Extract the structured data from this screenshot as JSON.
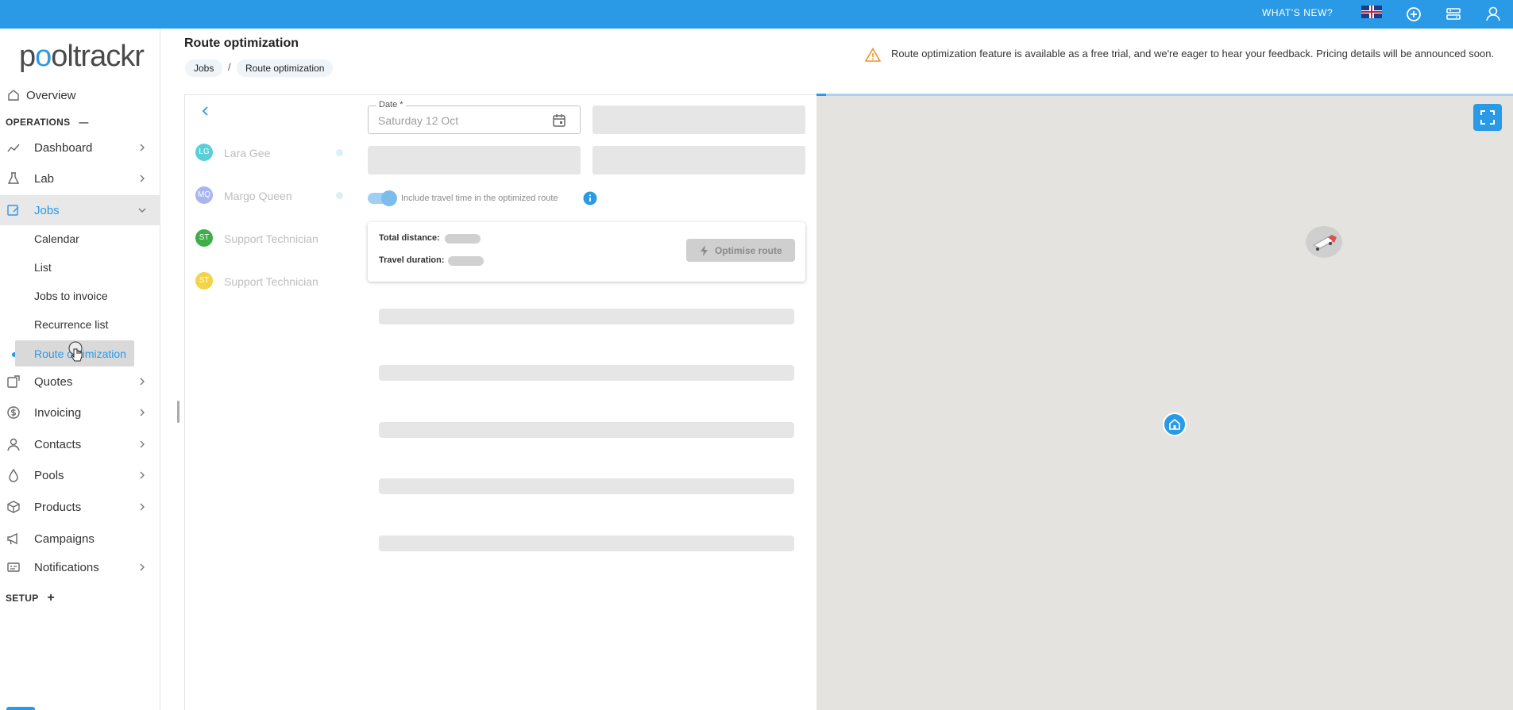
{
  "header": {
    "whats_new": "WHAT'S NEW?",
    "accent_color": "#2a9ae6"
  },
  "logo": {
    "text_pre": "p",
    "text_pin": "o",
    "text_post": "oltrackr"
  },
  "sidebar": {
    "overview": "Overview",
    "operations_label": "OPERATIONS",
    "operations_toggle": "—",
    "items": [
      {
        "label": "Dashboard",
        "icon": "chart-line-icon"
      },
      {
        "label": "Lab",
        "icon": "flask-icon"
      },
      {
        "label": "Jobs",
        "icon": "jobs-icon"
      },
      {
        "label": "Quotes",
        "icon": "quote-icon"
      },
      {
        "label": "Invoicing",
        "icon": "dollar-circle-icon"
      },
      {
        "label": "Contacts",
        "icon": "person-icon"
      },
      {
        "label": "Pools",
        "icon": "drop-icon"
      },
      {
        "label": "Products",
        "icon": "box-icon"
      },
      {
        "label": "Campaigns",
        "icon": "megaphone-icon"
      },
      {
        "label": "Notifications",
        "icon": "notification-icon"
      }
    ],
    "jobs_sub": [
      "Calendar",
      "List",
      "Jobs to invoice",
      "Recurrence list",
      "Route optimization"
    ],
    "setup_label": "SETUP",
    "setup_toggle": "+"
  },
  "page": {
    "title": "Route optimization",
    "breadcrumb": [
      "Jobs",
      "Route optimization"
    ],
    "breadcrumb_sep": "/",
    "notice": "Route optimization feature is available as a free trial, and we're eager to hear your feedback. Pricing details will be announced soon."
  },
  "technicians": [
    {
      "initials": "LG",
      "name": "Lara Gee",
      "color": "#5bcfd8"
    },
    {
      "initials": "MQ",
      "name": "Margo Queen",
      "color": "#a8b5ef"
    },
    {
      "initials": "ST",
      "name": "Support Technician",
      "color": "#3fae49"
    },
    {
      "initials": "ST",
      "name": "Support Technician",
      "color": "#f2d34a"
    }
  ],
  "form": {
    "date_label": "Date *",
    "date_value": "Saturday 12 Oct",
    "toggle_label": "Include travel time in the optimized route",
    "toggle_on": true
  },
  "summary": {
    "distance_label": "Total distance:",
    "duration_label": "Travel duration:",
    "optimise_button": "Optimise route"
  }
}
